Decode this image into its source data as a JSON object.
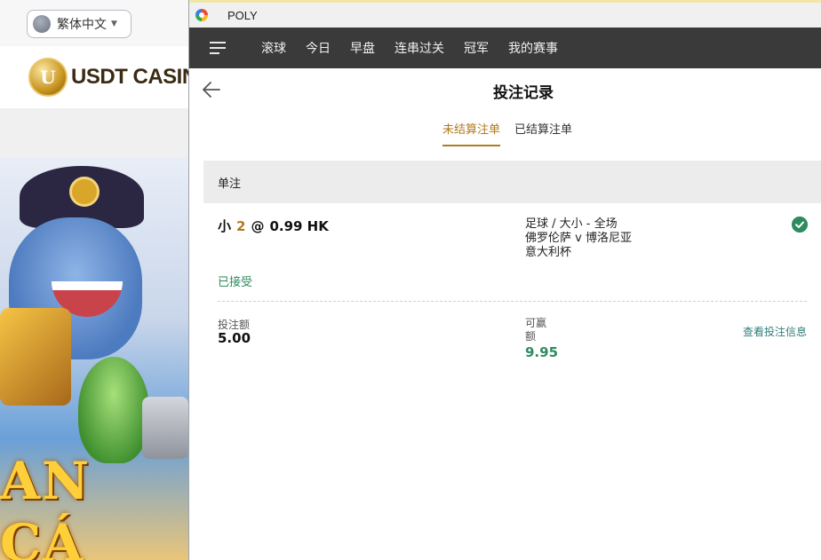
{
  "background_site": {
    "language_select": {
      "value": "繁体中文"
    },
    "logo": {
      "coin_letter": "U",
      "text": "USDT CASIN"
    },
    "banner": {
      "title_text": "AN CÁ"
    }
  },
  "window": {
    "title": "POLY",
    "nav": {
      "items": [
        "滚球",
        "今日",
        "早盘",
        "连串过关",
        "冠军",
        "我的赛事"
      ]
    },
    "page": {
      "title": "投注记录",
      "tabs": [
        {
          "label": "未结算注单",
          "active": true
        },
        {
          "label": "已结算注单",
          "active": false
        }
      ],
      "section_label": "单注",
      "bet": {
        "selection": "小",
        "line": "2",
        "at": "@",
        "odds": "0.99 HK",
        "market": "足球 / 大小 - 全场",
        "match": "佛罗伦萨 v 博洛尼亚",
        "league": "意大利杯",
        "status": "已接受",
        "stake_label": "投注额",
        "stake_value": "5.00",
        "win_label": "可赢额",
        "win_value": "9.95",
        "detail_link": "查看投注信息"
      }
    }
  },
  "colors": {
    "accent_gold": "#b07a1e",
    "success_green": "#2e8b5e",
    "navbar_bg": "#3a3a3a",
    "link_teal": "#2e7d7d"
  }
}
